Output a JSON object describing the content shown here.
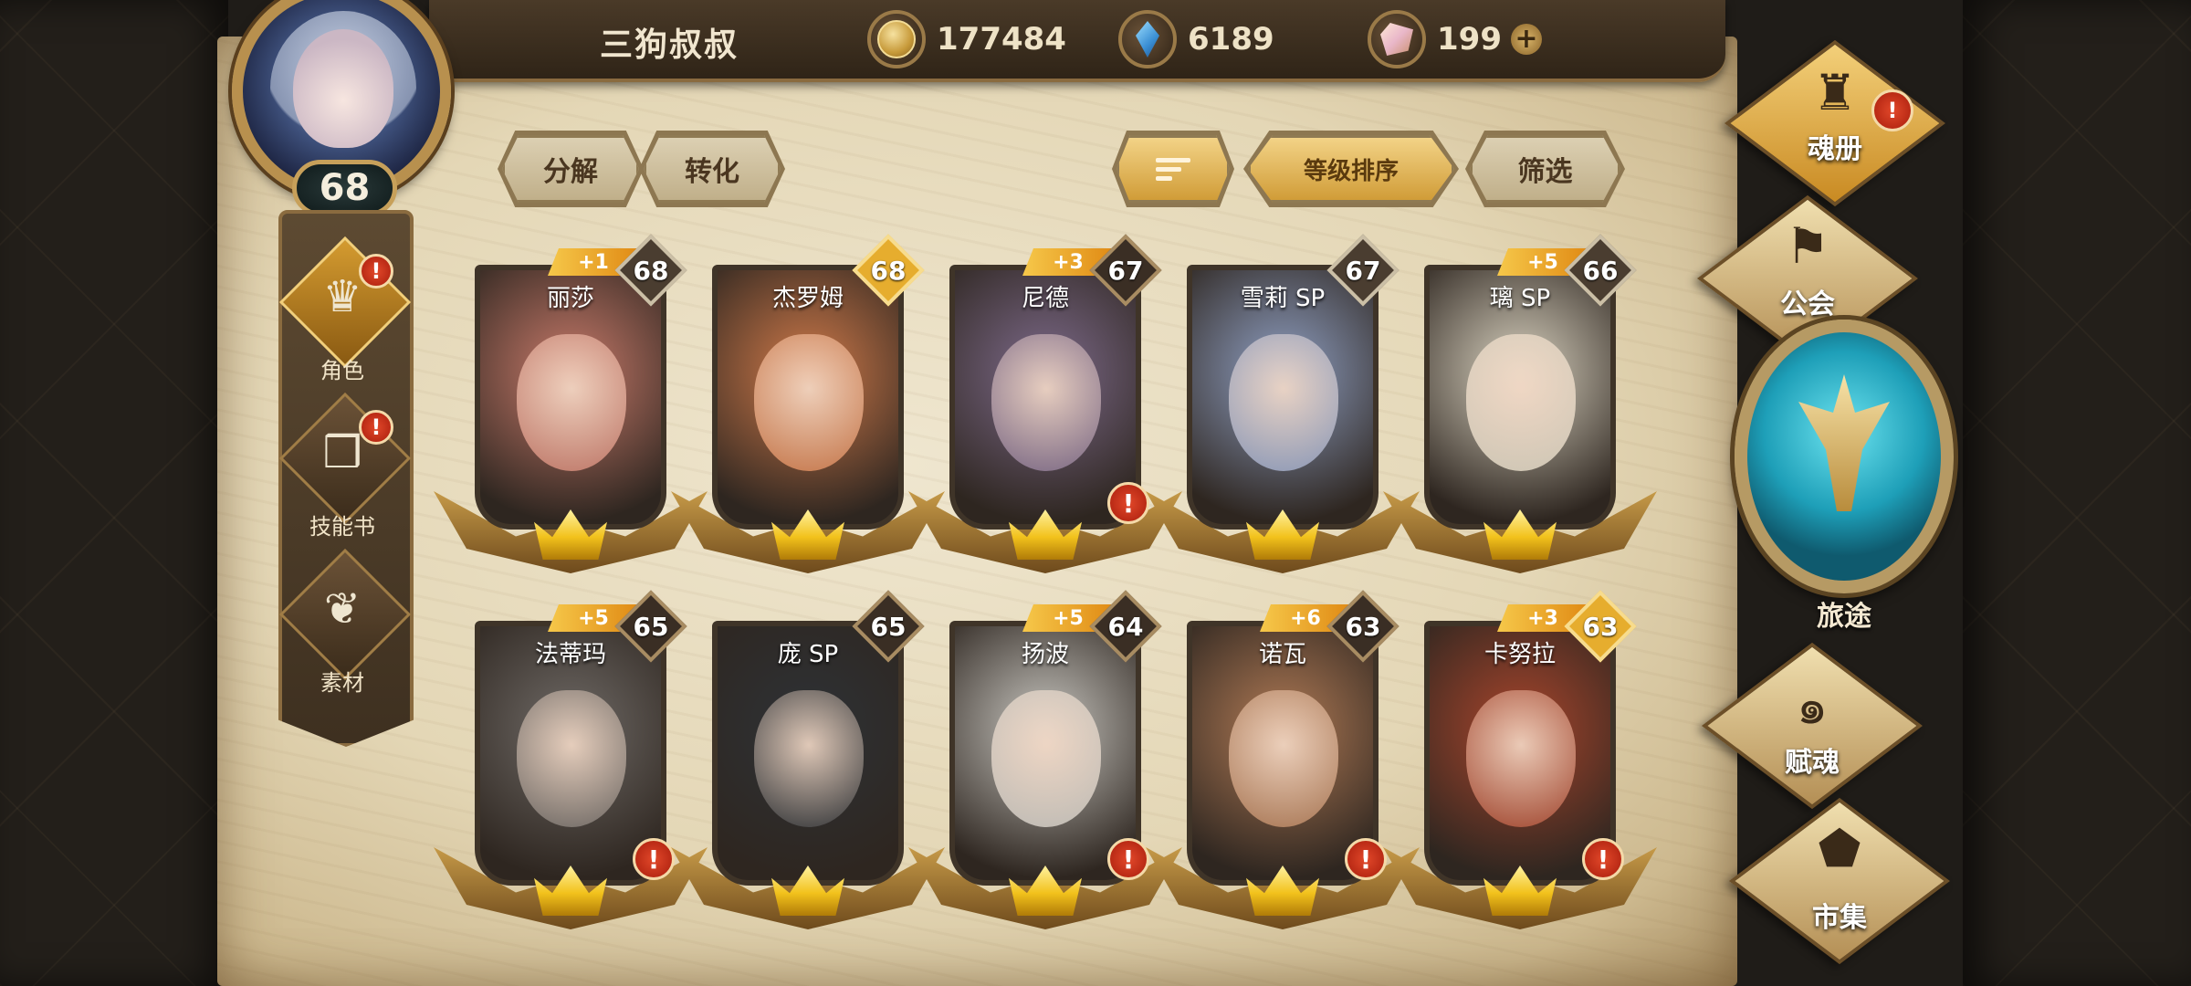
{
  "player": {
    "name": "三狗叔叔",
    "level": "68"
  },
  "currencies": [
    {
      "icon": "gold-coin-icon",
      "value": "177484"
    },
    {
      "icon": "blue-gem-icon",
      "value": "6189"
    },
    {
      "icon": "crystal-icon",
      "value": "199"
    }
  ],
  "currency_plus": "+",
  "alert_mark": "!",
  "left_nav": [
    {
      "label": "角色",
      "icon": "role-icon",
      "active": true,
      "alert": true
    },
    {
      "label": "技能书",
      "icon": "skill-book-icon",
      "active": false,
      "alert": true
    },
    {
      "label": "素材",
      "icon": "material-icon",
      "active": false,
      "alert": false
    }
  ],
  "actions": {
    "decompose": "分解",
    "convert": "转化",
    "sort_by_level": "等级排序",
    "filter": "筛选"
  },
  "heroes": [
    {
      "name": "丽莎",
      "level": "68",
      "bonus": "+1",
      "alert": false,
      "badge": "silver",
      "color": "#c87a6a"
    },
    {
      "name": "杰罗姆",
      "level": "68",
      "bonus": "",
      "alert": false,
      "badge": "gold",
      "color": "#d07a4a"
    },
    {
      "name": "尼德",
      "level": "67",
      "bonus": "+3",
      "alert": true,
      "badge": "dark",
      "color": "#7d6a8a"
    },
    {
      "name": "雪莉 SP",
      "level": "67",
      "bonus": "",
      "alert": false,
      "badge": "silver",
      "color": "#8f9fc2"
    },
    {
      "name": "璃 SP",
      "level": "66",
      "bonus": "+5",
      "alert": false,
      "badge": "silver",
      "color": "#d9d2c0"
    },
    {
      "name": "法蒂玛",
      "level": "65",
      "bonus": "+5",
      "alert": true,
      "badge": "dark",
      "color": "#6f6a66"
    },
    {
      "name": "庞 SP",
      "level": "65",
      "bonus": "",
      "alert": false,
      "badge": "dark",
      "color": "#2e3236"
    },
    {
      "name": "扬波",
      "level": "64",
      "bonus": "+5",
      "alert": true,
      "badge": "dark",
      "color": "#c8c6c0"
    },
    {
      "name": "诺瓦",
      "level": "63",
      "bonus": "+6",
      "alert": true,
      "badge": "dark",
      "color": "#b07a55"
    },
    {
      "name": "卡努拉",
      "level": "63",
      "bonus": "+3",
      "alert": true,
      "badge": "gold",
      "color": "#a8452c"
    }
  ],
  "right_nav": [
    {
      "label": "魂册",
      "icon": "soul-book-icon",
      "alert": true,
      "active": true
    },
    {
      "label": "公会",
      "icon": "guild-icon",
      "alert": false,
      "active": false
    },
    {
      "label": "旅途",
      "icon": "journey-emblem-icon",
      "alert": false,
      "active": false
    },
    {
      "label": "赋魂",
      "icon": "ensoul-icon",
      "alert": false,
      "active": false
    },
    {
      "label": "市集",
      "icon": "market-icon",
      "alert": false,
      "active": false
    }
  ]
}
